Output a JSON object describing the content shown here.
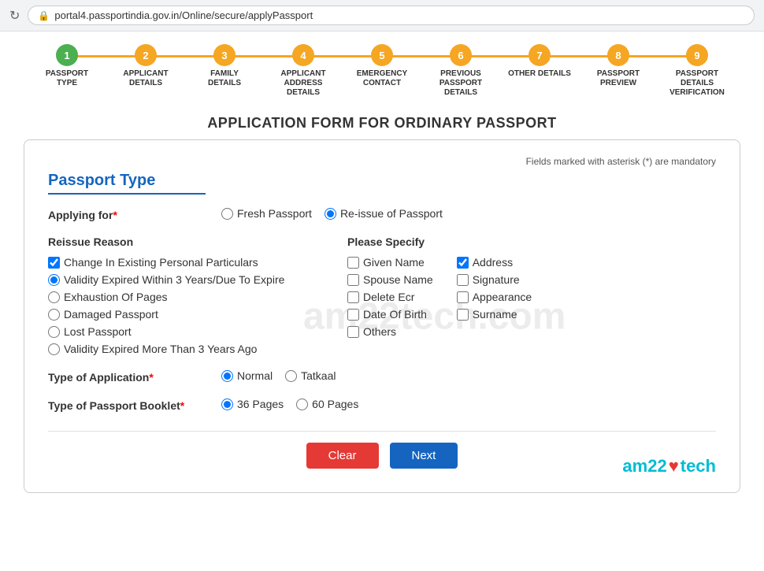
{
  "browser": {
    "url": "portal4.passportindia.gov.in/Online/secure/applyPassport",
    "refresh_icon": "↻",
    "lock_icon": "🔒"
  },
  "steps": [
    {
      "number": "1",
      "label": "PASSPORT TYPE",
      "status": "active"
    },
    {
      "number": "2",
      "label": "APPLICANT DETAILS",
      "status": "pending"
    },
    {
      "number": "3",
      "label": "FAMILY DETAILS",
      "status": "pending"
    },
    {
      "number": "4",
      "label": "APPLICANT ADDRESS DETAILS",
      "status": "pending"
    },
    {
      "number": "5",
      "label": "EMERGENCY CONTACT",
      "status": "pending"
    },
    {
      "number": "6",
      "label": "PREVIOUS PASSPORT DETAILS",
      "status": "pending"
    },
    {
      "number": "7",
      "label": "OTHER DETAILS",
      "status": "pending"
    },
    {
      "number": "8",
      "label": "PASSPORT PREVIEW",
      "status": "pending"
    },
    {
      "number": "9",
      "label": "PASSPORT DETAILS VERIFICATION",
      "status": "pending"
    }
  ],
  "page_title": "APPLICATION FORM FOR ORDINARY PASSPORT",
  "form": {
    "section_title": "Passport Type",
    "mandatory_note": "Fields marked with asterisk (*) are mandatory",
    "applying_for": {
      "label": "Applying for",
      "required": true,
      "options": [
        "Fresh Passport",
        "Re-issue of Passport"
      ],
      "selected": "Re-issue of Passport"
    },
    "reissue_reason": {
      "label": "Reissue Reason",
      "options": [
        {
          "text": "Change In Existing Personal Particulars",
          "type": "checkbox",
          "checked": true
        },
        {
          "text": "Validity Expired Within 3 Years/Due To Expire",
          "type": "radio",
          "checked": true
        },
        {
          "text": "Exhaustion Of Pages",
          "type": "radio",
          "checked": false
        },
        {
          "text": "Damaged Passport",
          "type": "radio",
          "checked": false
        },
        {
          "text": "Lost Passport",
          "type": "radio",
          "checked": false
        },
        {
          "text": "Validity Expired More Than 3 Years Ago",
          "type": "radio",
          "checked": false
        }
      ]
    },
    "please_specify": {
      "label": "Please Specify",
      "col1": [
        {
          "text": "Given Name",
          "checked": false
        },
        {
          "text": "Spouse Name",
          "checked": false
        },
        {
          "text": "Delete Ecr",
          "checked": false
        },
        {
          "text": "Date Of Birth",
          "checked": false
        },
        {
          "text": "Others",
          "checked": false
        }
      ],
      "col2": [
        {
          "text": "Address",
          "checked": true
        },
        {
          "text": "Signature",
          "checked": false
        },
        {
          "text": "Appearance",
          "checked": false
        },
        {
          "text": "Surname",
          "checked": false
        }
      ]
    },
    "type_of_application": {
      "label": "Type of Application",
      "required": true,
      "options": [
        "Normal",
        "Tatkaal"
      ],
      "selected": "Normal"
    },
    "type_of_booklet": {
      "label": "Type of Passport Booklet",
      "required": true,
      "options": [
        "36 Pages",
        "60 Pages"
      ],
      "selected": "36 Pages"
    },
    "buttons": {
      "clear": "Clear",
      "next": "Next"
    }
  },
  "watermark": "am22tech.com",
  "branding": {
    "text_left": "am22",
    "heart": "♥",
    "text_right": "tech"
  }
}
